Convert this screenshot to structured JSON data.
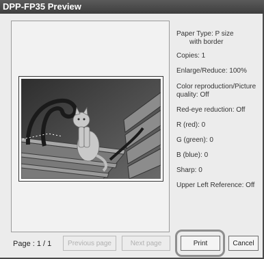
{
  "window": {
    "title": "DPP-FP35 Preview"
  },
  "settings": {
    "paper_type_line1": "Paper Type: P size",
    "paper_type_line2": "with border",
    "copies": "Copies: 1",
    "enlarge_reduce": "Enlarge/Reduce: 100%",
    "color_repro_line1": "Color reproduction/Picture",
    "color_repro_line2": "quality: Off",
    "red_eye": "Red-eye reduction: Off",
    "r_red": "R (red): 0",
    "g_green": "G (green): 0",
    "b_blue": "B (blue): 0",
    "sharp": "Sharp: 0",
    "upper_left_reference": "Upper Left Reference: Off"
  },
  "footer": {
    "page_indicator": "Page : 1 / 1",
    "previous_page_label": "Previous page",
    "next_page_label": "Next page",
    "print_label": "Print",
    "cancel_label": "Cancel"
  },
  "preview": {
    "image_subject": "cat-on-bench-photo"
  }
}
